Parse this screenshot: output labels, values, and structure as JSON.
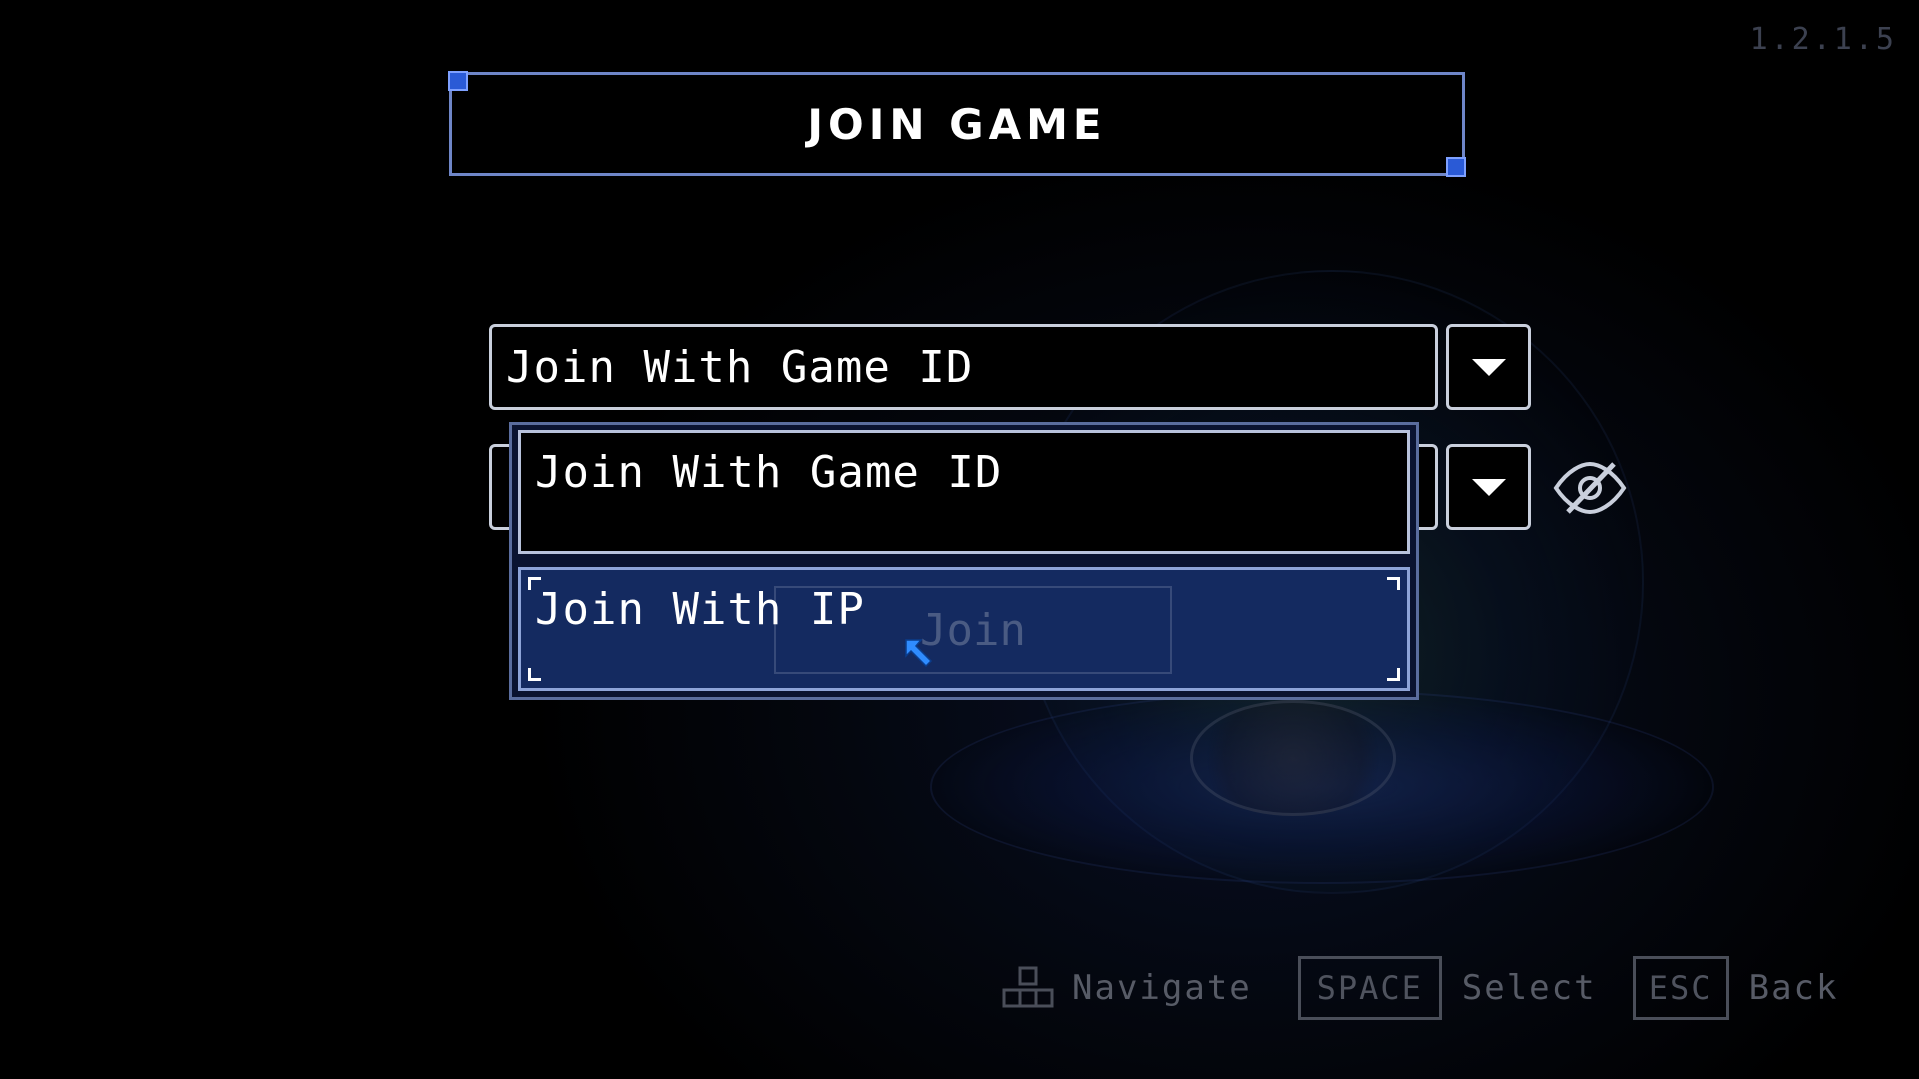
{
  "version": "1.2.1.5",
  "title": "JOIN GAME",
  "mode_select": {
    "selected": "Join With Game ID",
    "options": [
      "Join With Game ID",
      "Join With IP"
    ],
    "highlighted_index": 1
  },
  "join_button": {
    "label": "Join"
  },
  "hints": {
    "navigate": "Navigate",
    "space_key": "SPACE",
    "select": "Select",
    "esc_key": "ESC",
    "back": "Back"
  },
  "icons": {
    "dropdown": "chevron-down-icon",
    "visibility": "eye-slash-icon",
    "navigate": "keyboard-arrows-icon",
    "cursor": "mouse-pointer-icon"
  },
  "colors": {
    "accent": "#6f86c8",
    "highlight_bg": "#142a60",
    "hint_text": "#575b66"
  }
}
